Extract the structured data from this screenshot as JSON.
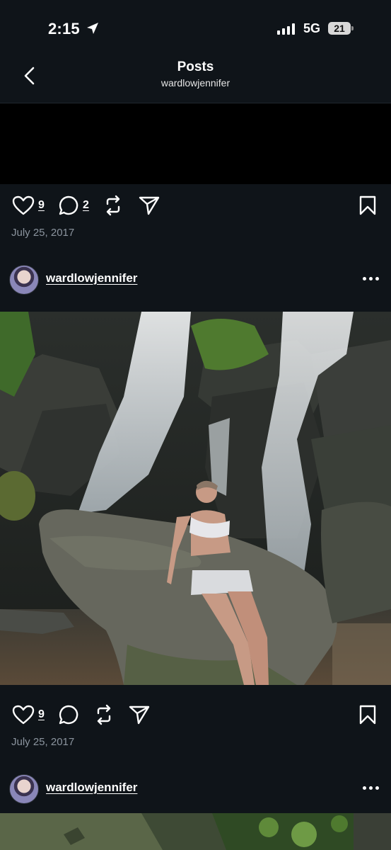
{
  "status_bar": {
    "time": "2:15",
    "network": "5G",
    "battery": "21"
  },
  "header": {
    "title": "Posts",
    "subtitle": "wardlowjennifer"
  },
  "posts": [
    {
      "likes": "9",
      "comments": "2",
      "date": "July 25, 2017"
    },
    {
      "author": "wardlowjennifer",
      "likes": "9",
      "comments": "",
      "date": "July 25, 2017"
    },
    {
      "author": "wardlowjennifer"
    }
  ],
  "colors": {
    "background": "#0f1419",
    "muted_text": "#8b949e"
  }
}
